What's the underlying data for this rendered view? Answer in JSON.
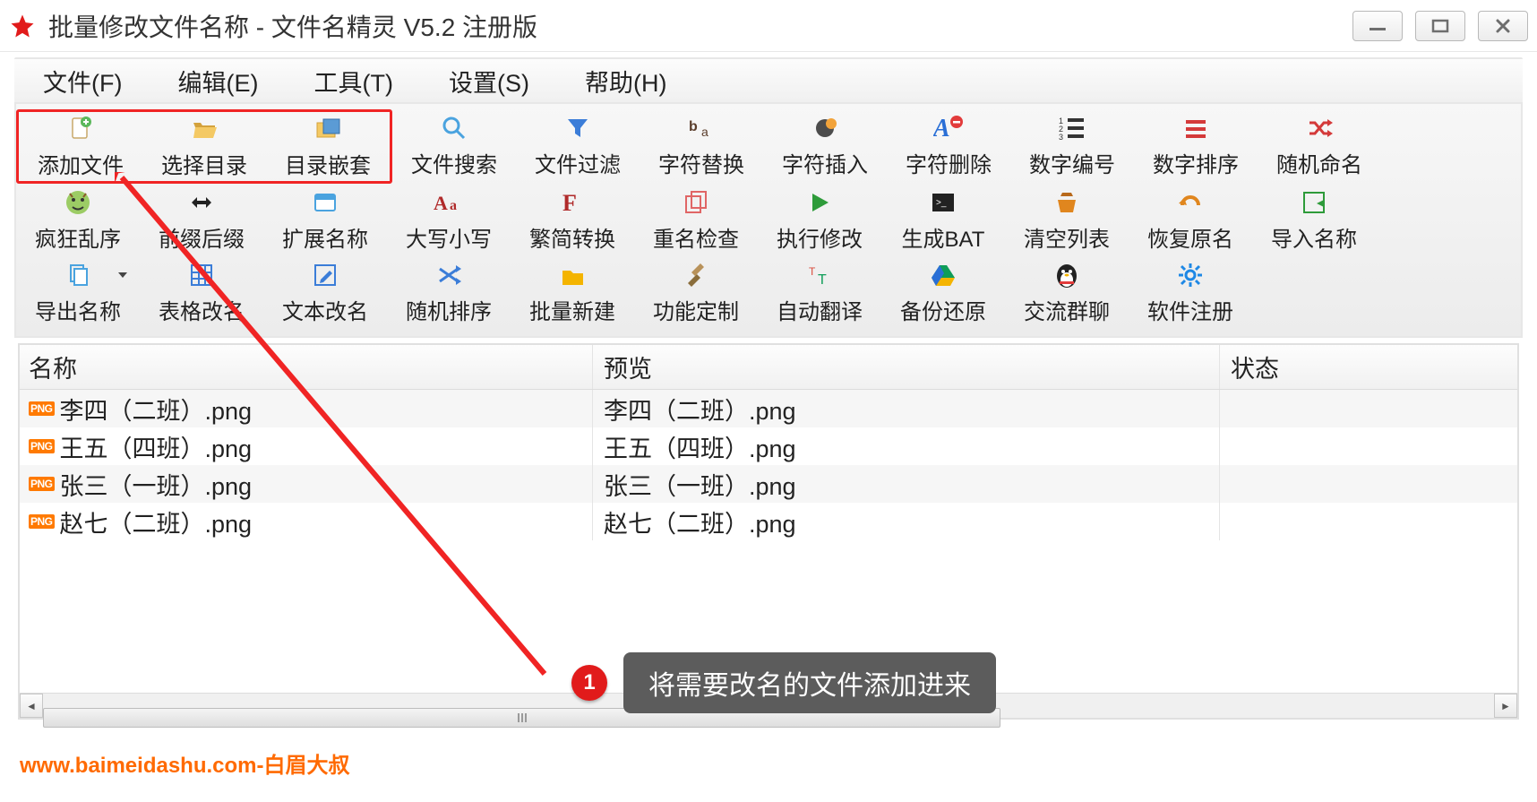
{
  "window": {
    "title": "批量修改文件名称 - 文件名精灵 V5.2 注册版"
  },
  "menubar": {
    "items": [
      "文件(F)",
      "编辑(E)",
      "工具(T)",
      "设置(S)",
      "帮助(H)"
    ]
  },
  "toolbar": {
    "rows": [
      [
        {
          "label": "添加文件",
          "icon": "file-add",
          "color": "#6aa84f"
        },
        {
          "label": "选择目录",
          "icon": "folder-open",
          "color": "#e8a33d"
        },
        {
          "label": "目录嵌套",
          "icon": "folder-nest",
          "color": "#e8a33d"
        },
        {
          "label": "文件搜索",
          "icon": "search",
          "color": "#4aa3df"
        },
        {
          "label": "文件过滤",
          "icon": "funnel",
          "color": "#3b7dd8"
        },
        {
          "label": "字符替换",
          "icon": "char-replace",
          "color": "#5a3d2b"
        },
        {
          "label": "字符插入",
          "icon": "char-insert",
          "color": "#d48f1e"
        },
        {
          "label": "字符删除",
          "icon": "char-delete",
          "color": "#2a6fd6"
        },
        {
          "label": "数字编号",
          "icon": "number-list",
          "color": "#333"
        },
        {
          "label": "数字排序",
          "icon": "sort-lines",
          "color": "#d43a3a"
        },
        {
          "label": "随机命名",
          "icon": "shuffle",
          "color": "#d43a3a"
        }
      ],
      [
        {
          "label": "疯狂乱序",
          "icon": "face",
          "color": "#8bc34a"
        },
        {
          "label": "前缀后缀",
          "icon": "arrows-h",
          "color": "#222"
        },
        {
          "label": "扩展名称",
          "icon": "ext",
          "color": "#4aa3df"
        },
        {
          "label": "大写小写",
          "icon": "case",
          "color": "#b02a2a"
        },
        {
          "label": "繁简转换",
          "icon": "trad",
          "color": "#b02a2a"
        },
        {
          "label": "重名检查",
          "icon": "dup",
          "color": "#e06666"
        },
        {
          "label": "执行修改",
          "icon": "play",
          "color": "#2e9b3a"
        },
        {
          "label": "生成BAT",
          "icon": "terminal",
          "color": "#222"
        },
        {
          "label": "清空列表",
          "icon": "clear",
          "color": "#e0861e"
        },
        {
          "label": "恢复原名",
          "icon": "undo",
          "color": "#e0861e"
        },
        {
          "label": "导入名称",
          "icon": "import",
          "color": "#2e9b3a"
        }
      ],
      [
        {
          "label": "导出名称",
          "icon": "export",
          "color": "#4aa3df",
          "dropdown": true
        },
        {
          "label": "表格改名",
          "icon": "grid",
          "color": "#3b7dd8"
        },
        {
          "label": "文本改名",
          "icon": "text-edit",
          "color": "#3b7dd8"
        },
        {
          "label": "随机排序",
          "icon": "shuffle2",
          "color": "#3b7dd8"
        },
        {
          "label": "批量新建",
          "icon": "folder-new",
          "color": "#f4b400"
        },
        {
          "label": "功能定制",
          "icon": "tools",
          "color": "#8a6d3b"
        },
        {
          "label": "自动翻译",
          "icon": "translate",
          "color": "#0f9d58"
        },
        {
          "label": "备份还原",
          "icon": "drive",
          "color": "#0f9d58"
        },
        {
          "label": "交流群聊",
          "icon": "penguin",
          "color": "#1e88e5"
        },
        {
          "label": "软件注册",
          "icon": "gear",
          "color": "#1e88e5"
        }
      ]
    ],
    "highlight_first_n": 3
  },
  "table": {
    "headers": {
      "name": "名称",
      "preview": "预览",
      "status": "状态"
    },
    "rows": [
      {
        "name": "李四（二班）.png",
        "preview": "李四（二班）.png",
        "status": ""
      },
      {
        "name": "王五（四班）.png",
        "preview": "王五（四班）.png",
        "status": ""
      },
      {
        "name": "张三（一班）.png",
        "preview": "张三（一班）.png",
        "status": ""
      },
      {
        "name": "赵七（二班）.png",
        "preview": "赵七（二班）.png",
        "status": ""
      }
    ],
    "file_badge": "PNG"
  },
  "annotation": {
    "step_number": "1",
    "step_text": "将需要改名的文件添加进来"
  },
  "watermark": "www.baimeidashu.com-白眉大叔"
}
